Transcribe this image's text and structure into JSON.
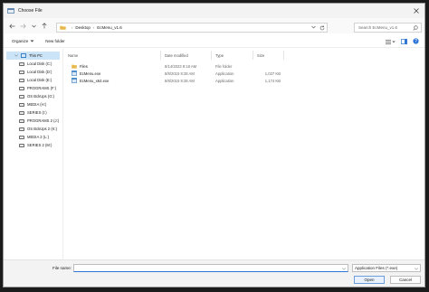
{
  "window": {
    "title": "Choose File"
  },
  "address": {
    "crumbs": [
      "Desktop",
      "EcMenu_v1.6"
    ]
  },
  "search": {
    "placeholder": "Search EcMenu_v1.6"
  },
  "toolbar": {
    "organize": "Organize",
    "new_folder": "New folder"
  },
  "nav": {
    "items": [
      "This PC",
      "Local Disk (C:)",
      "Local Disk (D:)",
      "Local Disk (E:)",
      "PROGRAMS (F:)",
      "OS BckUps (G:)",
      "MEDIA (H:)",
      "SERIES (I:)",
      "PROGRAMS 2 (J:)",
      "OS BckUps 2 (K:)",
      "MEDIA 2 (L:)",
      "SERIES 2 (M:)"
    ]
  },
  "columns": {
    "name": "Name",
    "date": "Date modified",
    "type": "Type",
    "size": "Size"
  },
  "files": [
    {
      "name": "Files",
      "date": "8/14/2023 9:18 AM",
      "type": "File folder",
      "size": "",
      "icon": "folder-icon"
    },
    {
      "name": "EcMenu.exe",
      "date": "8/8/2015 8:28 AM",
      "type": "Application",
      "size": "1,027 KB",
      "icon": "app-icon"
    },
    {
      "name": "EcMenu_x64.exe",
      "date": "8/8/2015 8:28 AM",
      "type": "Application",
      "size": "1,174 KB",
      "icon": "app-icon"
    }
  ],
  "footer": {
    "filename_label": "File name:",
    "filename_value": "",
    "filetype": "Application Files (*.exe)",
    "open": "Open",
    "cancel": "Cancel"
  },
  "colors": {
    "accent": "#2f75d6",
    "selection": "#cce4f7",
    "folder": "#e8b84a"
  }
}
